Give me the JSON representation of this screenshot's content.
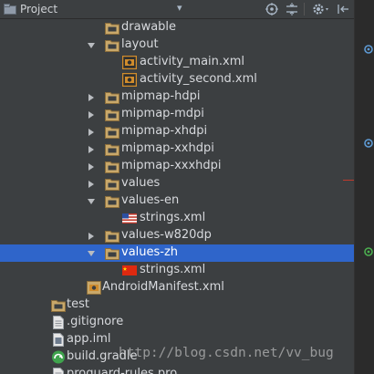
{
  "header": {
    "title": "Project",
    "dropdown_glyph": "▾"
  },
  "tree": [
    {
      "label": "drawable",
      "icon": "folder",
      "arrow": "none",
      "indent": 1
    },
    {
      "label": "layout",
      "icon": "folder",
      "arrow": "down",
      "indent": 1
    },
    {
      "label": "activity_main.xml",
      "icon": "xml-layout",
      "arrow": "none",
      "indent": 2
    },
    {
      "label": "activity_second.xml",
      "icon": "xml-layout",
      "arrow": "none",
      "indent": 2
    },
    {
      "label": "mipmap-hdpi",
      "icon": "folder",
      "arrow": "right",
      "indent": 1
    },
    {
      "label": "mipmap-mdpi",
      "icon": "folder",
      "arrow": "right",
      "indent": 1
    },
    {
      "label": "mipmap-xhdpi",
      "icon": "folder",
      "arrow": "right",
      "indent": 1
    },
    {
      "label": "mipmap-xxhdpi",
      "icon": "folder",
      "arrow": "right",
      "indent": 1
    },
    {
      "label": "mipmap-xxxhdpi",
      "icon": "folder",
      "arrow": "right",
      "indent": 1
    },
    {
      "label": "values",
      "icon": "folder",
      "arrow": "right",
      "indent": 1
    },
    {
      "label": "values-en",
      "icon": "folder",
      "arrow": "down",
      "indent": 1
    },
    {
      "label": "strings.xml",
      "icon": "flag-us",
      "arrow": "none",
      "indent": 2
    },
    {
      "label": "values-w820dp",
      "icon": "folder",
      "arrow": "right",
      "indent": 1
    },
    {
      "label": "values-zh",
      "icon": "folder",
      "arrow": "down",
      "indent": 1,
      "selected": true
    },
    {
      "label": "strings.xml",
      "icon": "flag-cn",
      "arrow": "none",
      "indent": 2
    },
    {
      "label": "AndroidManifest.xml",
      "icon": "manifest",
      "arrow": "none",
      "indent": 0
    },
    {
      "label": "test",
      "icon": "folder",
      "arrow": "right",
      "indent": -1
    },
    {
      "label": ".gitignore",
      "icon": "text-file",
      "arrow": "none",
      "indent": -1
    },
    {
      "label": "app.iml",
      "icon": "iml-file",
      "arrow": "none",
      "indent": -1
    },
    {
      "label": "build.gradle",
      "icon": "gradle-file",
      "arrow": "none",
      "indent": -1
    },
    {
      "label": "proguard-rules.pro",
      "icon": "text-file",
      "arrow": "none",
      "indent": -1
    }
  ],
  "watermark": "http://blog.csdn.net/vv_bug",
  "colors": {
    "background": "#3c3f41",
    "selection": "#2f65ca",
    "folder": "#c9a86a",
    "xml_orange": "#d08c2c"
  }
}
